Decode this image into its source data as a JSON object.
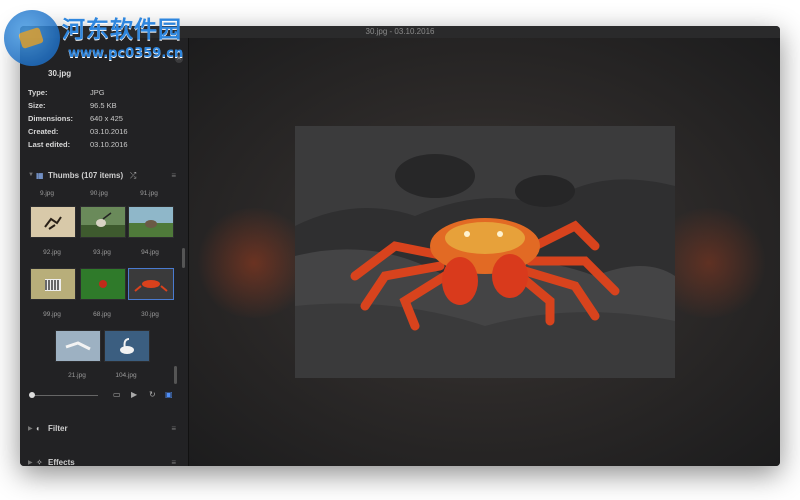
{
  "window": {
    "title": "30.jpg - 03.10.2016"
  },
  "watermark": {
    "name": "河东软件园",
    "url": "www.pc0359.cn"
  },
  "info": {
    "filename": "30.jpg",
    "rows": [
      {
        "label": "Type:",
        "value": "JPG"
      },
      {
        "label": "Size:",
        "value": "96.5 KB"
      },
      {
        "label": "Dimensions:",
        "value": "640 x 425"
      },
      {
        "label": "Created:",
        "value": "03.10.2016"
      },
      {
        "label": "Last edited:",
        "value": "03.10.2016"
      }
    ]
  },
  "thumbs": {
    "title": "Thumbs (107 items)",
    "top_labels": [
      "9.jpg",
      "90.jpg",
      "91.jpg"
    ],
    "items": [
      {
        "label": "92.jpg"
      },
      {
        "label": "93.jpg"
      },
      {
        "label": "94.jpg"
      },
      {
        "label": "99.jpg"
      },
      {
        "label": "68.jpg"
      },
      {
        "label": "30.jpg",
        "selected": true
      },
      {
        "label": "21.jpg"
      },
      {
        "label": "104.jpg"
      }
    ]
  },
  "sections": {
    "filter": "Filter",
    "effects": "Effects"
  },
  "icons": {
    "thumbs": "grid-icon",
    "shuffle": "shuffle-icon",
    "menu": "hamburger-icon",
    "folder": "folder-icon",
    "slideshow": "slideshow-icon",
    "refresh": "refresh-icon",
    "view": "view-mode-icon",
    "filter": "filter-icon",
    "effects": "effects-icon"
  },
  "colors": {
    "accent": "#4f8ef7",
    "panel": "#222224",
    "window": "#1b1b1c"
  }
}
